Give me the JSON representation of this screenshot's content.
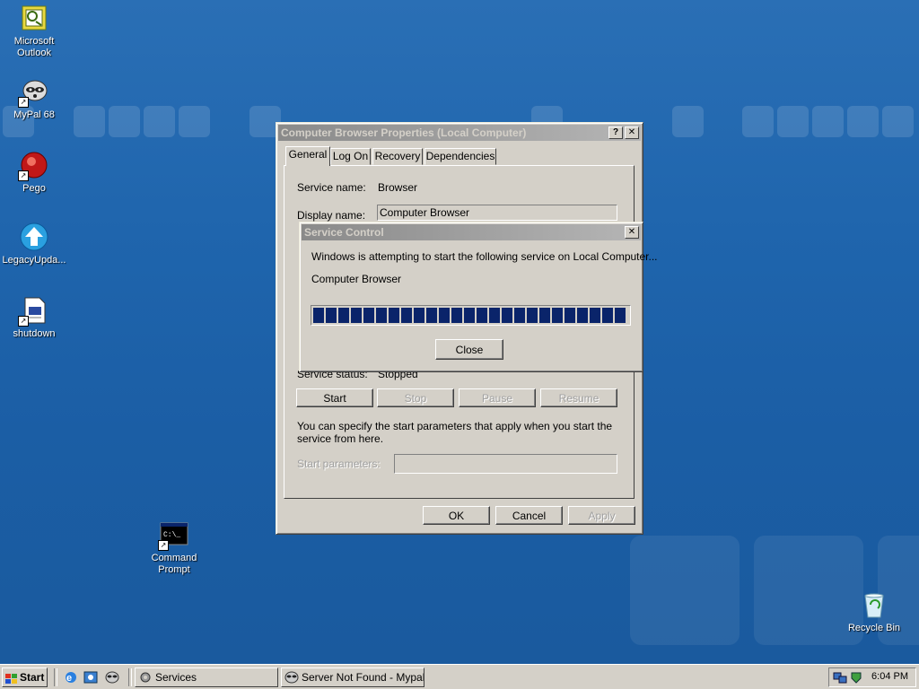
{
  "desktop": {
    "icons": [
      {
        "label": "Microsoft\nOutlook",
        "icon": "outlook-icon"
      },
      {
        "label": "MyPal 68",
        "icon": "raccoon-icon"
      },
      {
        "label": "Pego",
        "icon": "pego-icon"
      },
      {
        "label": "LegacyUpda...",
        "icon": "update-arrow-icon"
      },
      {
        "label": "shutdown",
        "icon": "document-icon"
      },
      {
        "label": "Command\nPrompt",
        "icon": "cmd-icon"
      },
      {
        "label": "Recycle Bin",
        "icon": "recycle-bin-icon"
      }
    ]
  },
  "properties_dialog": {
    "title": "Computer Browser Properties (Local Computer)",
    "help_btn": "?",
    "close_btn": "✕",
    "tabs": [
      "General",
      "Log On",
      "Recovery",
      "Dependencies"
    ],
    "service_name_label": "Service name:",
    "service_name_value": "Browser",
    "display_name_label": "Display name:",
    "display_name_value": "Computer Browser",
    "service_status_label": "Service status:",
    "service_status_value": "Stopped",
    "start_btn": "Start",
    "stop_btn": "Stop",
    "pause_btn": "Pause",
    "resume_btn": "Resume",
    "hint": "You can specify the start parameters that apply when you start the service from here.",
    "start_params_label": "Start parameters:",
    "start_params_value": "",
    "ok_btn": "OK",
    "cancel_btn": "Cancel",
    "apply_btn": "Apply"
  },
  "service_control": {
    "title": "Service Control",
    "close_btn": "✕",
    "message": "Windows is attempting to start the following service on Local Computer...",
    "service": "Computer Browser",
    "progress": 1.0,
    "close_label": "Close"
  },
  "taskbar": {
    "start_label": "Start",
    "quicklaunch": [
      "ie-icon",
      "outlook-express-icon",
      "mypal-icon"
    ],
    "tasks": [
      {
        "label": "Services",
        "icon": "gear-icon"
      },
      {
        "label": "Server Not Found - Mypal",
        "icon": "raccoon-icon"
      }
    ],
    "clock": "6:04 PM"
  }
}
